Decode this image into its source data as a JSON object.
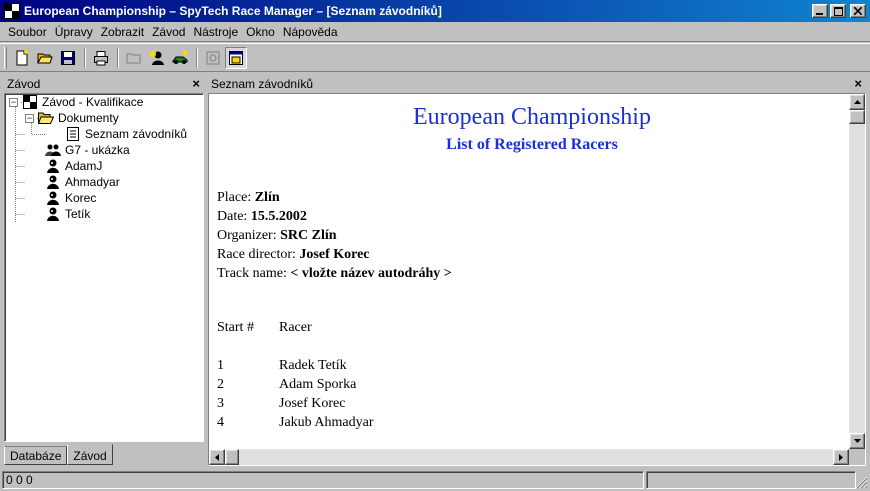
{
  "window": {
    "title": "European Championship – SpyTech Race Manager – [Seznam závodníků]",
    "controls": [
      "minimize-icon",
      "maximize-icon",
      "close-icon"
    ]
  },
  "menu": [
    "Soubor",
    "Úpravy",
    "Zobrazit",
    "Závod",
    "Nástroje",
    "Okno",
    "Nápověda"
  ],
  "toolbar": {
    "buttons": [
      "new-document-icon",
      "open-folder-icon",
      "save-icon",
      "print-icon",
      "folder-disabled-icon",
      "add-racer-icon",
      "race-car-icon",
      "settings-disabled-icon",
      "window-view-icon"
    ]
  },
  "left_panel": {
    "title": "Závod",
    "close": "×",
    "tree": [
      {
        "label": "Závod - Kvalifikace",
        "icon": "checkered-flag-icon",
        "level": 0,
        "expander": "−"
      },
      {
        "label": "Dokumenty",
        "icon": "folder-open-icon",
        "level": 1,
        "expander": "−"
      },
      {
        "label": "Seznam závodníků",
        "icon": "document-icon",
        "level": 2,
        "expander": ""
      },
      {
        "label": "G7 - ukázka",
        "icon": "group-icon",
        "level": 1,
        "expander": ""
      },
      {
        "label": "AdamJ",
        "icon": "racer-icon",
        "level": 1,
        "expander": ""
      },
      {
        "label": "Ahmadyar",
        "icon": "racer-icon",
        "level": 1,
        "expander": ""
      },
      {
        "label": "Korec",
        "icon": "racer-icon",
        "level": 1,
        "expander": ""
      },
      {
        "label": "Tetík",
        "icon": "racer-icon",
        "level": 1,
        "expander": ""
      }
    ],
    "tabs": [
      "Databáze",
      "Závod"
    ],
    "active_tab": "Závod"
  },
  "doc_panel": {
    "title": "Seznam závodníků",
    "close": "×"
  },
  "document": {
    "title": "European Championship",
    "subtitle": "List of Registered Racers",
    "title_color": "#1b2fd8",
    "info": [
      {
        "label": "Place: ",
        "value": "Zlín"
      },
      {
        "label": "Date: ",
        "value": "15.5.2002"
      },
      {
        "label": "Organizer: ",
        "value": "SRC Zlín"
      },
      {
        "label": "Race director: ",
        "value": "Josef Korec"
      },
      {
        "label": "Track name: ",
        "value": "< vložte název autodráhy >"
      }
    ],
    "table": {
      "headers": [
        "Start #",
        "Racer"
      ],
      "rows": [
        [
          "1",
          "Radek Tetík"
        ],
        [
          "2",
          "Adam Sporka"
        ],
        [
          "3",
          "Josef Korec"
        ],
        [
          "4",
          "Jakub Ahmadyar"
        ]
      ]
    }
  },
  "status": {
    "text": "0 0 0"
  }
}
